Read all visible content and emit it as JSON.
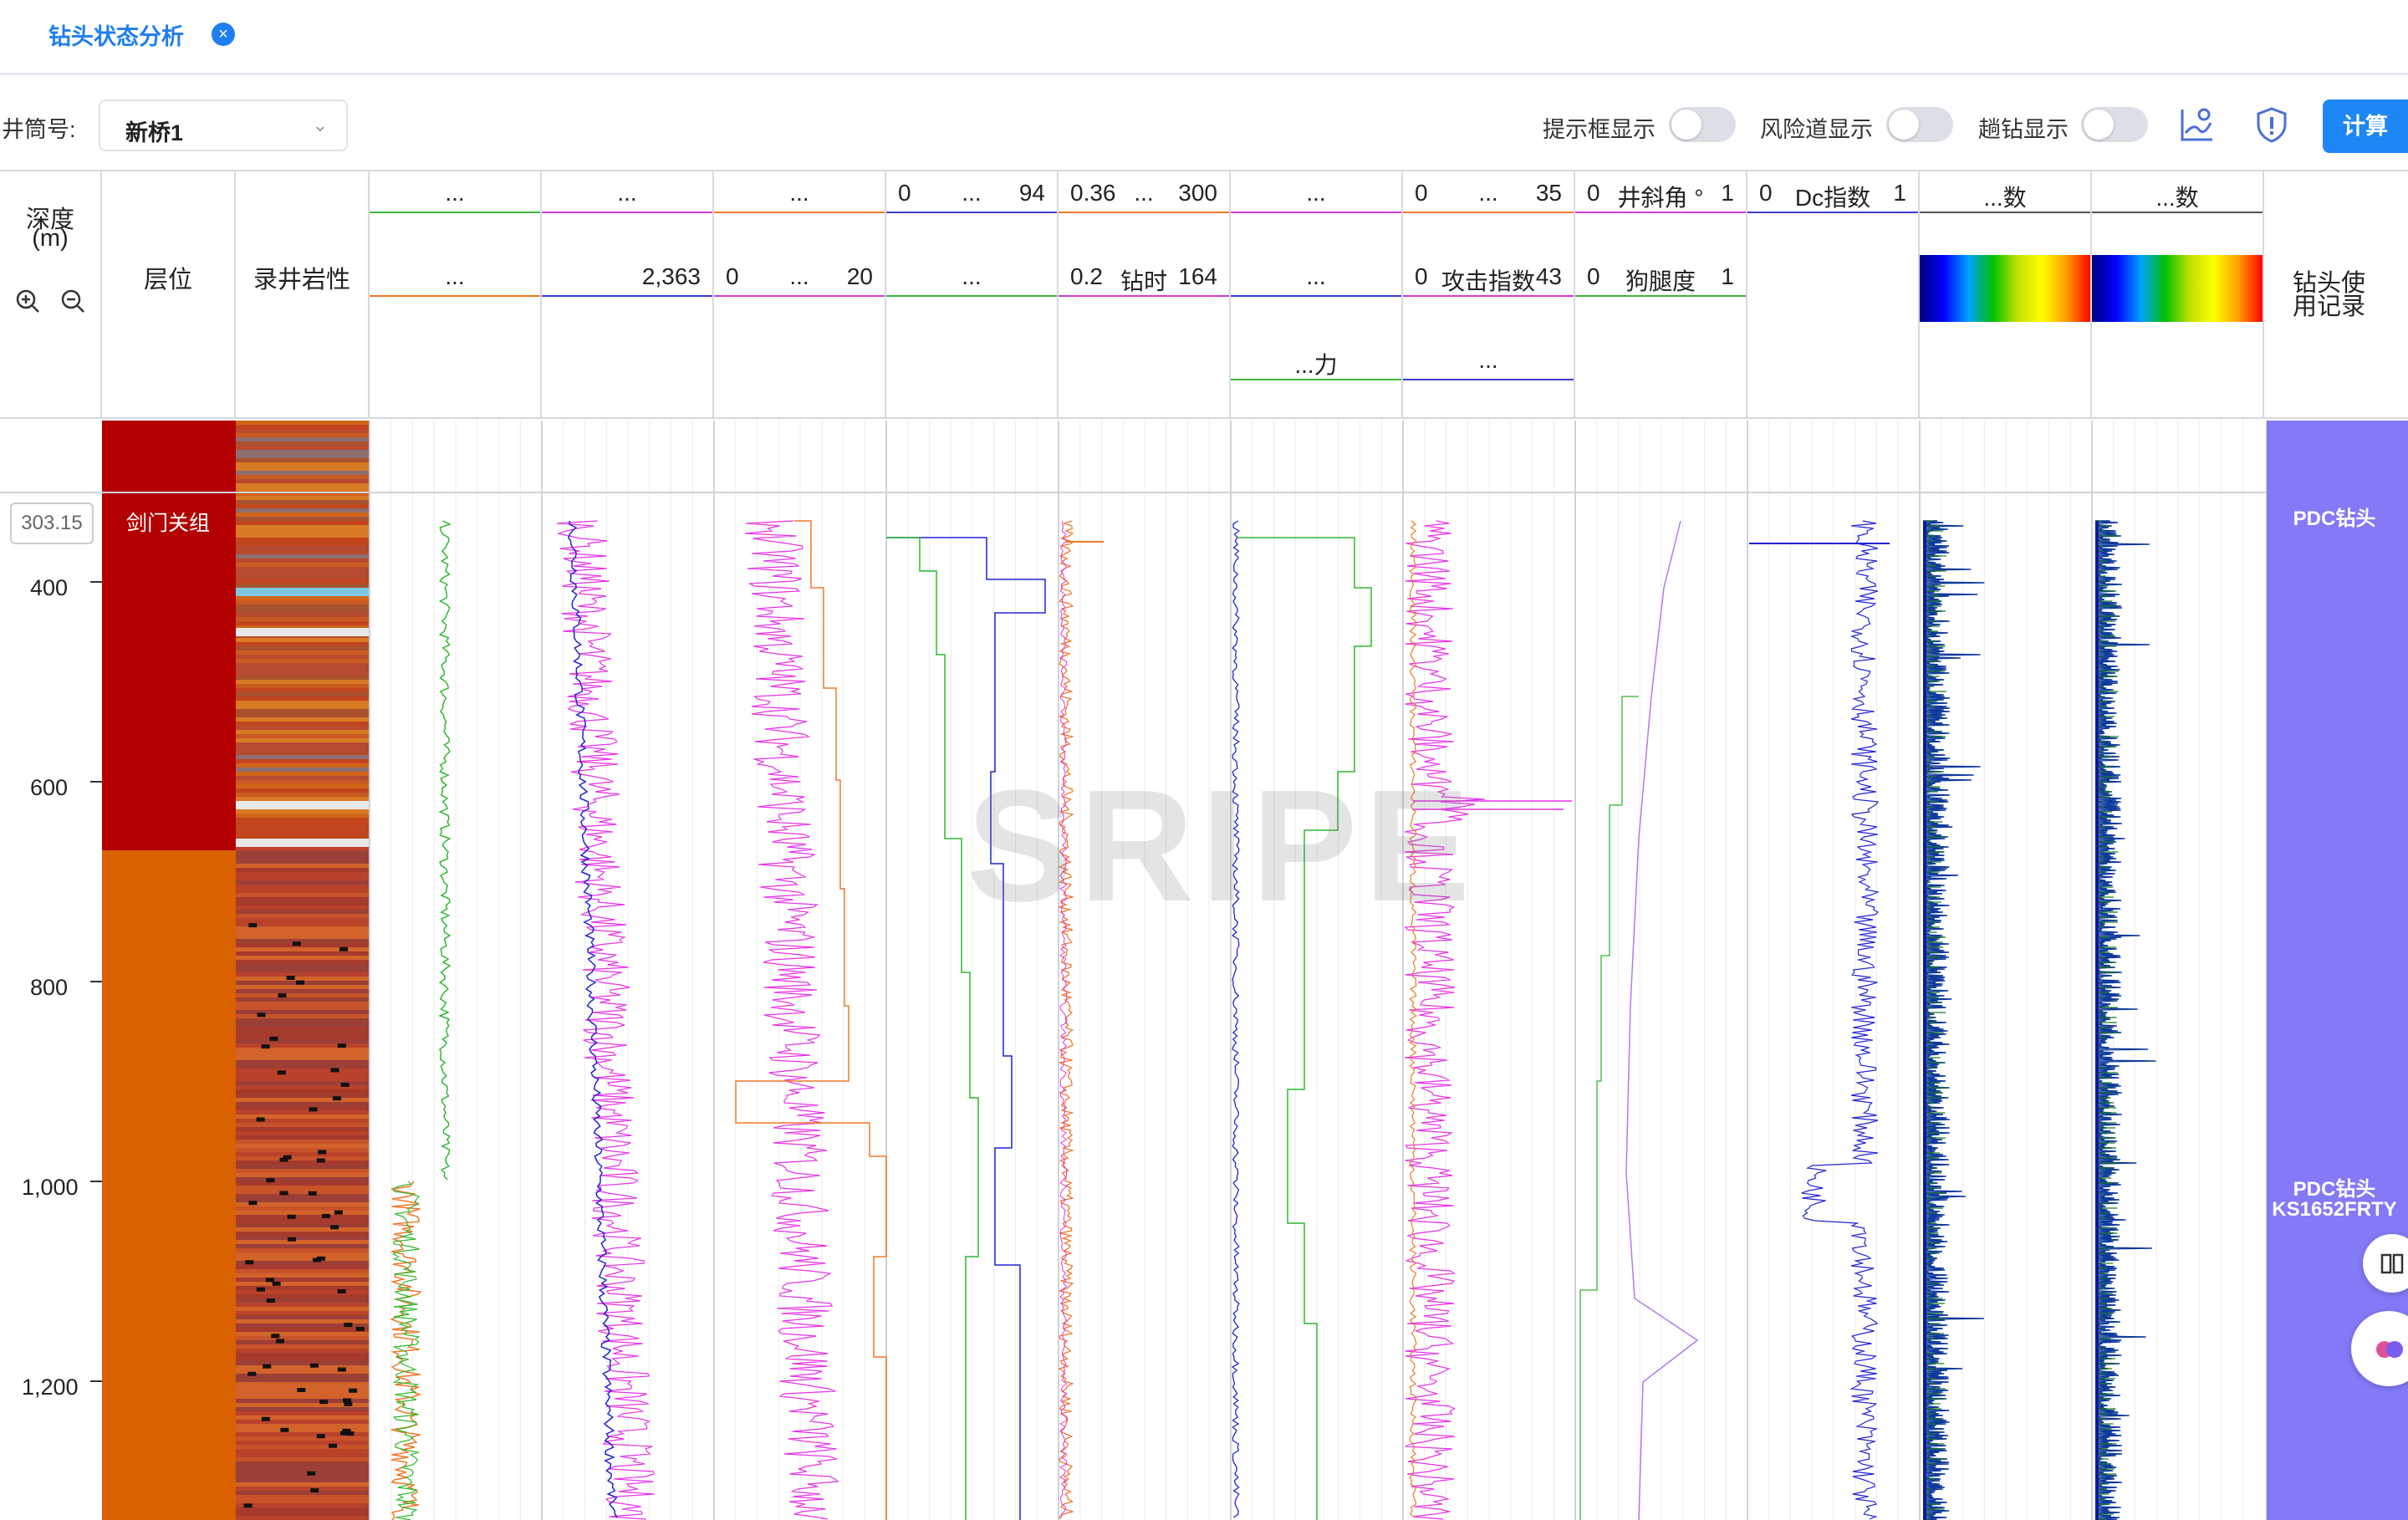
{
  "tab": {
    "title": "钻头状态分析",
    "close_icon": "close-icon"
  },
  "toolbar": {
    "well_label": "井筒号:",
    "well_value": "新桥1",
    "toggles": [
      {
        "label": "提示框显示",
        "on": false
      },
      {
        "label": "风险道显示",
        "on": false
      },
      {
        "label": "趟钻显示",
        "on": false
      }
    ],
    "calc_label": "计算"
  },
  "header": {
    "depth_title": "深度",
    "depth_unit": "(m)",
    "layer_title": "层位",
    "litho_title": "录井岩性",
    "bit_record_title": "钻头使用记录",
    "tracks": [
      {
        "rows": [
          {
            "c": "...",
            "color": "#3cb43c"
          },
          {
            "c": "...",
            "color": "#f07828"
          }
        ]
      },
      {
        "rows": [
          {
            "c": "...",
            "color": "#d23cd2"
          },
          {
            "r": "2,363",
            "color": "#3c3cd2"
          }
        ]
      },
      {
        "rows": [
          {
            "c": "...",
            "color": "#f07828"
          },
          {
            "l": "0",
            "c": "...",
            "r": "20",
            "color": "#d23cd2"
          }
        ]
      },
      {
        "rows": [
          {
            "l": "0",
            "c": "...",
            "r": "94",
            "color": "#3c3cd2"
          },
          {
            "c": "...",
            "color": "#3cb43c"
          }
        ]
      },
      {
        "rows": [
          {
            "l": "0.36",
            "c": "...",
            "r": "300",
            "color": "#f07828"
          },
          {
            "l": "0.2",
            "c": "钻时",
            "r": "164",
            "color": "#d23cd2"
          }
        ]
      },
      {
        "rows": [
          {
            "c": "...",
            "color": "#d23cd2"
          },
          {
            "c": "...",
            "color": "#3c3cd2"
          },
          {
            "c": "...力",
            "color": "#3cb43c"
          }
        ]
      },
      {
        "rows": [
          {
            "l": "0",
            "c": "...",
            "r": "35",
            "color": "#f07828"
          },
          {
            "l": "0",
            "c": "攻击指数",
            "r": "43",
            "color": "#d23cd2"
          },
          {
            "c": "...",
            "color": "#3c3cd2"
          }
        ]
      },
      {
        "rows": [
          {
            "l": "0",
            "c": "井斜角 °",
            "r": "1",
            "color": "#d23cd2"
          },
          {
            "l": "0",
            "c": "狗腿度",
            "r": "1",
            "color": "#3cb43c"
          }
        ]
      },
      {
        "rows": [
          {
            "l": "0",
            "c": "Dc指数",
            "r": "1",
            "color": "#3c3cd2"
          }
        ]
      },
      {
        "rows": [
          {
            "c": "...数",
            "color": "#555555"
          }
        ],
        "colorbar": true
      },
      {
        "rows": [
          {
            "c": "...数",
            "color": "#555555"
          }
        ],
        "colorbar": true
      }
    ]
  },
  "plot": {
    "depth_readout": "303.15",
    "depth_ticks": [
      "400",
      "600",
      "800",
      "1,000",
      "1,200"
    ],
    "formation_label": "剑门关组",
    "formation_colors": {
      "upper": "#b30000",
      "lower": "#d96100"
    },
    "bit_labels": [
      "PDC钻头",
      "PDC钻头",
      "KS1652FRTY"
    ],
    "bit_color": "#8479f7",
    "watermark": "SRIPE"
  },
  "icons": {
    "chart": "chart-settings-icon",
    "shield": "shield-icon",
    "zoom_in": "zoom-in-icon",
    "zoom_out": "zoom-out-icon",
    "book": "book-icon",
    "brain": "brain-icon"
  }
}
